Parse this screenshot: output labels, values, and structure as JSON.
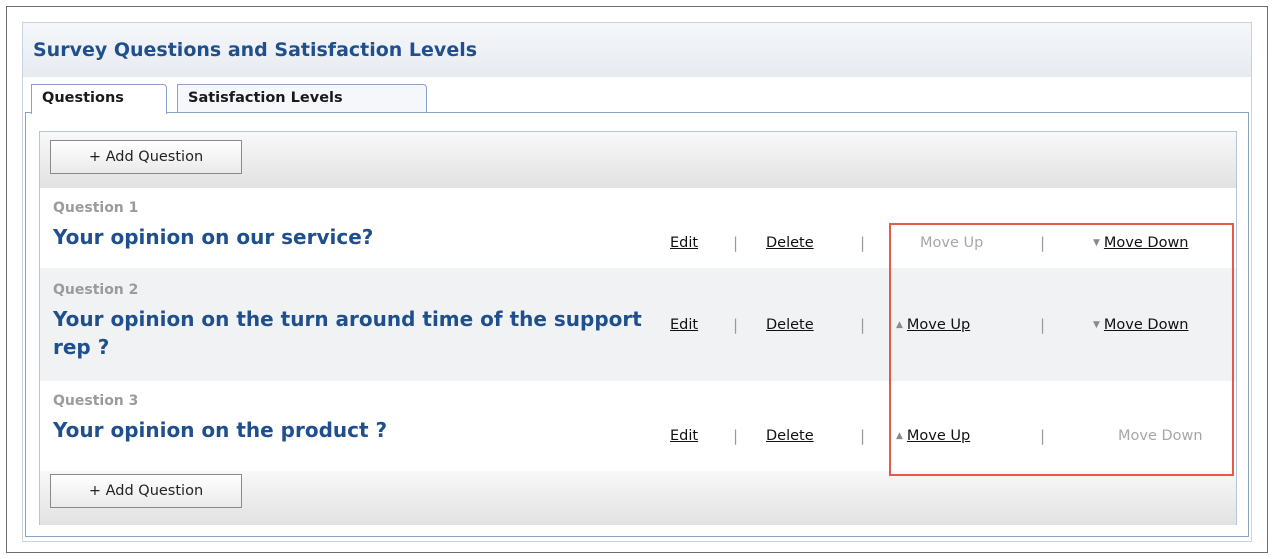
{
  "panel": {
    "title": "Survey Questions and Satisfaction Levels"
  },
  "tabs": [
    {
      "label": "Questions",
      "active": true
    },
    {
      "label": "Satisfaction Levels",
      "active": false
    }
  ],
  "add_button_label": "+ Add Question",
  "actions": {
    "edit": "Edit",
    "delete": "Delete",
    "move_up": "Move Up",
    "move_down": "Move Down",
    "separator": "|"
  },
  "icons": {
    "up": "▲",
    "down": "▼"
  },
  "questions": [
    {
      "number": "Question 1",
      "text": "Your opinion on our service?",
      "move_up_enabled": false,
      "move_down_enabled": true
    },
    {
      "number": "Question 2",
      "text": "Your opinion on the turn around time of the support rep ?",
      "move_up_enabled": true,
      "move_down_enabled": true
    },
    {
      "number": "Question 3",
      "text": "Your opinion on the product ?",
      "move_up_enabled": true,
      "move_down_enabled": false
    }
  ],
  "colors": {
    "title": "#1f4f8d",
    "highlight": "#e5584a"
  }
}
